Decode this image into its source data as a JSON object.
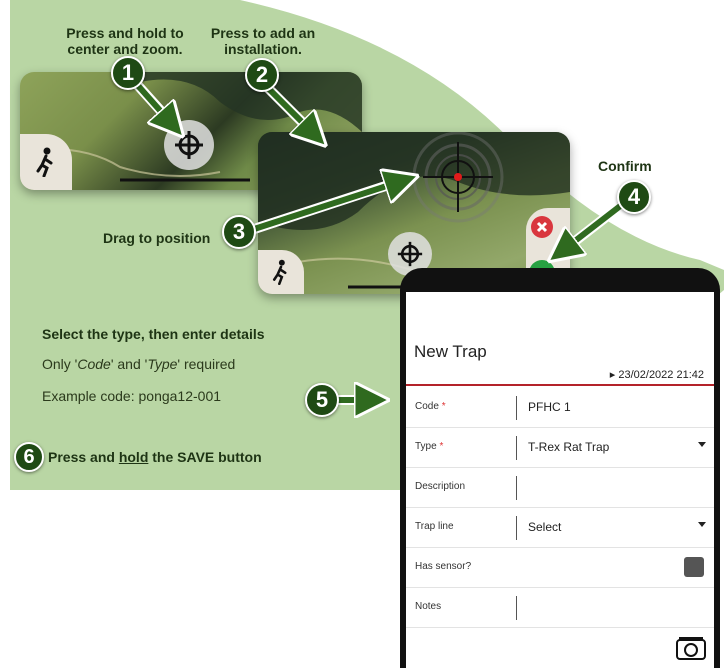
{
  "instructions": {
    "step1_label": "Press and hold to center and zoom.",
    "step2_label": "Press to add an installation.",
    "step3_label": "Drag to position",
    "step4_label": "Confirm",
    "details_heading": "Select the type, then enter details",
    "required_note_prefix": "Only '",
    "required_note_code": "Code",
    "required_note_mid": "' and '",
    "required_note_type": "Type",
    "required_note_suffix": "' required",
    "example_code": "Example code: ponga12-001",
    "step6_prefix": "Press and ",
    "step6_hold": "hold",
    "step6_suffix": " the SAVE button"
  },
  "steps": [
    "1",
    "2",
    "3",
    "4",
    "5",
    "6"
  ],
  "colors": {
    "background_green": "#b9d6a4",
    "step_badge": "#1f4a14",
    "arrow": "#2f6a1f",
    "confirm_green": "#27a142",
    "cancel_red": "#d9363e",
    "required_red": "#b4232a"
  },
  "icons": {
    "walk": "walking-person-icon",
    "crosshair": "crosshair-icon",
    "add": "plus-circle-icon",
    "cancel": "close-icon",
    "confirm": "check-icon",
    "camera": "camera-icon"
  },
  "form": {
    "title": "New Trap",
    "date": "▸ 23/02/2022 21:42",
    "fields": [
      {
        "label": "Code",
        "required": "*",
        "value": "PFHC 1"
      },
      {
        "label": "Type",
        "required": "*",
        "value": "T-Rex Rat Trap"
      },
      {
        "label": "Description",
        "required": "",
        "value": ""
      },
      {
        "label": "Trap line",
        "required": "",
        "value": "Select"
      },
      {
        "label": "Has sensor?",
        "required": "",
        "value": ""
      },
      {
        "label": "Notes",
        "required": "",
        "value": ""
      }
    ]
  }
}
